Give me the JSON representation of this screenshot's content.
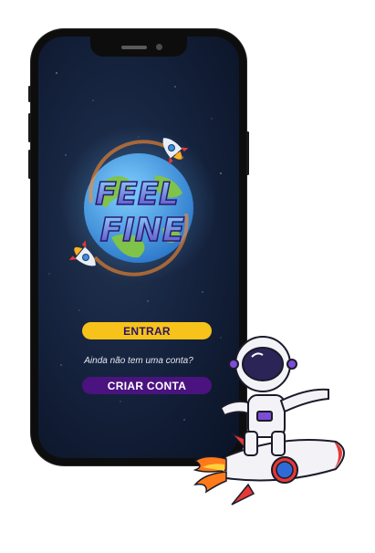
{
  "app": {
    "logo": {
      "text_line1": "FEEL",
      "text_line2": "FINE"
    },
    "buttons": {
      "enter_label": "ENTRAR",
      "create_account_label": "CRIAR CONTA"
    },
    "prompt_text": "Ainda não tem uma conta?"
  },
  "colors": {
    "accent_yellow": "#f7c31a",
    "accent_purple": "#4a137f",
    "background": "#172541",
    "button_text_dark": "#2b1266"
  },
  "icons": [
    "rocket-icon",
    "earth-icon",
    "astronaut-illustration"
  ]
}
